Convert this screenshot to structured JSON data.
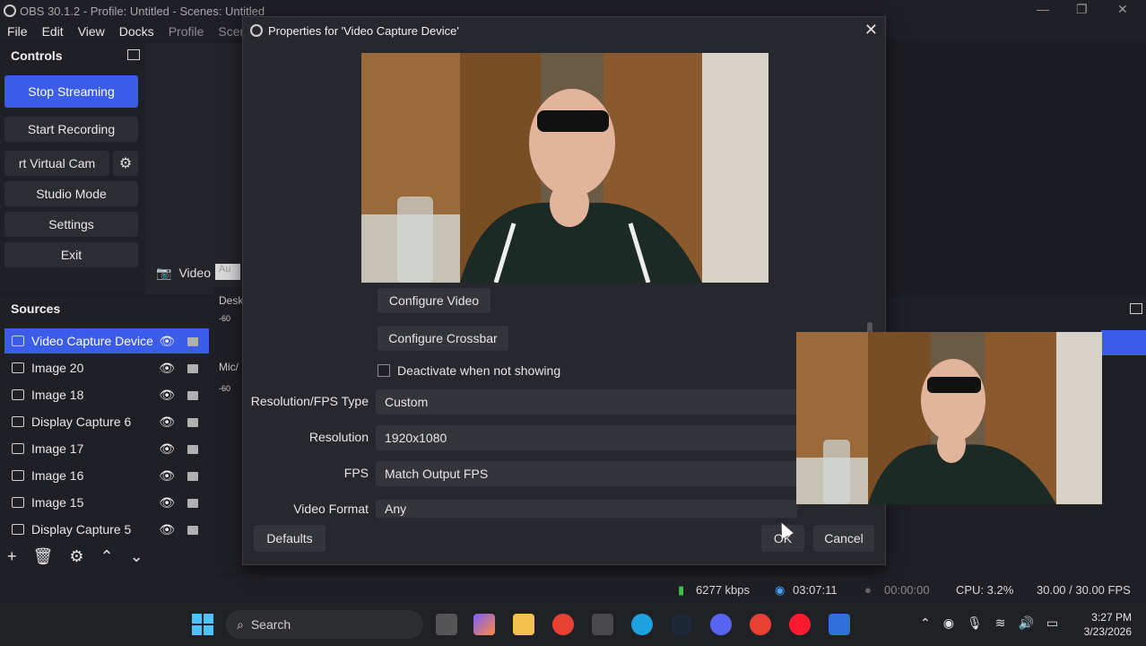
{
  "window": {
    "title": "OBS 30.1.2 - Profile: Untitled - Scenes: Untitled",
    "min": "—",
    "max": "❐",
    "close": "✕"
  },
  "menu": [
    "File",
    "Edit",
    "View",
    "Docks",
    "Profile",
    "Scene"
  ],
  "controls": {
    "header": "Controls",
    "buttons": [
      "Stop Streaming",
      "Start Recording",
      "rt Virtual Cam",
      "Studio Mode",
      "Settings",
      "Exit"
    ]
  },
  "scene_strip": {
    "label": "Video",
    "tab": "Au"
  },
  "sources": {
    "header": "Sources",
    "items": [
      {
        "name": "Video Capture Device",
        "icon": "camera-icon"
      },
      {
        "name": "Image 20",
        "icon": "image-icon"
      },
      {
        "name": "Image 18",
        "icon": "image-icon"
      },
      {
        "name": "Display Capture 6",
        "icon": "monitor-icon"
      },
      {
        "name": "Image 17",
        "icon": "image-icon"
      },
      {
        "name": "Image 16",
        "icon": "image-icon"
      },
      {
        "name": "Image 15",
        "icon": "image-icon"
      },
      {
        "name": "Display Capture 5",
        "icon": "monitor-icon"
      }
    ]
  },
  "audio": {
    "track1": "Desk",
    "track2": "Mic/",
    "level": "-60"
  },
  "dialog": {
    "title": "Properties for 'Video Capture Device'",
    "configure_video": "Configure Video",
    "configure_crossbar": "Configure Crossbar",
    "deactivate_label": "Deactivate when not showing",
    "props": [
      {
        "label": "Resolution/FPS Type",
        "value": "Custom"
      },
      {
        "label": "Resolution",
        "value": "1920x1080"
      },
      {
        "label": "FPS",
        "value": "Match Output FPS"
      },
      {
        "label": "Video Format",
        "value": "Any"
      }
    ],
    "defaults": "Defaults",
    "ok": "OK",
    "cancel": "Cancel"
  },
  "status": {
    "bitrate": "6277 kbps",
    "stream_time": "03:07:11",
    "rec_time": "00:00:00",
    "cpu": "CPU: 3.2%",
    "fps": "30.00 / 30.00 FPS"
  },
  "taskbar": {
    "search": "Search",
    "time": "3:27 PM",
    "date": "3/23/2026"
  },
  "colors": {
    "accent": "#3a5ce8",
    "panel": "#1f2026",
    "dialog": "#27282e"
  }
}
